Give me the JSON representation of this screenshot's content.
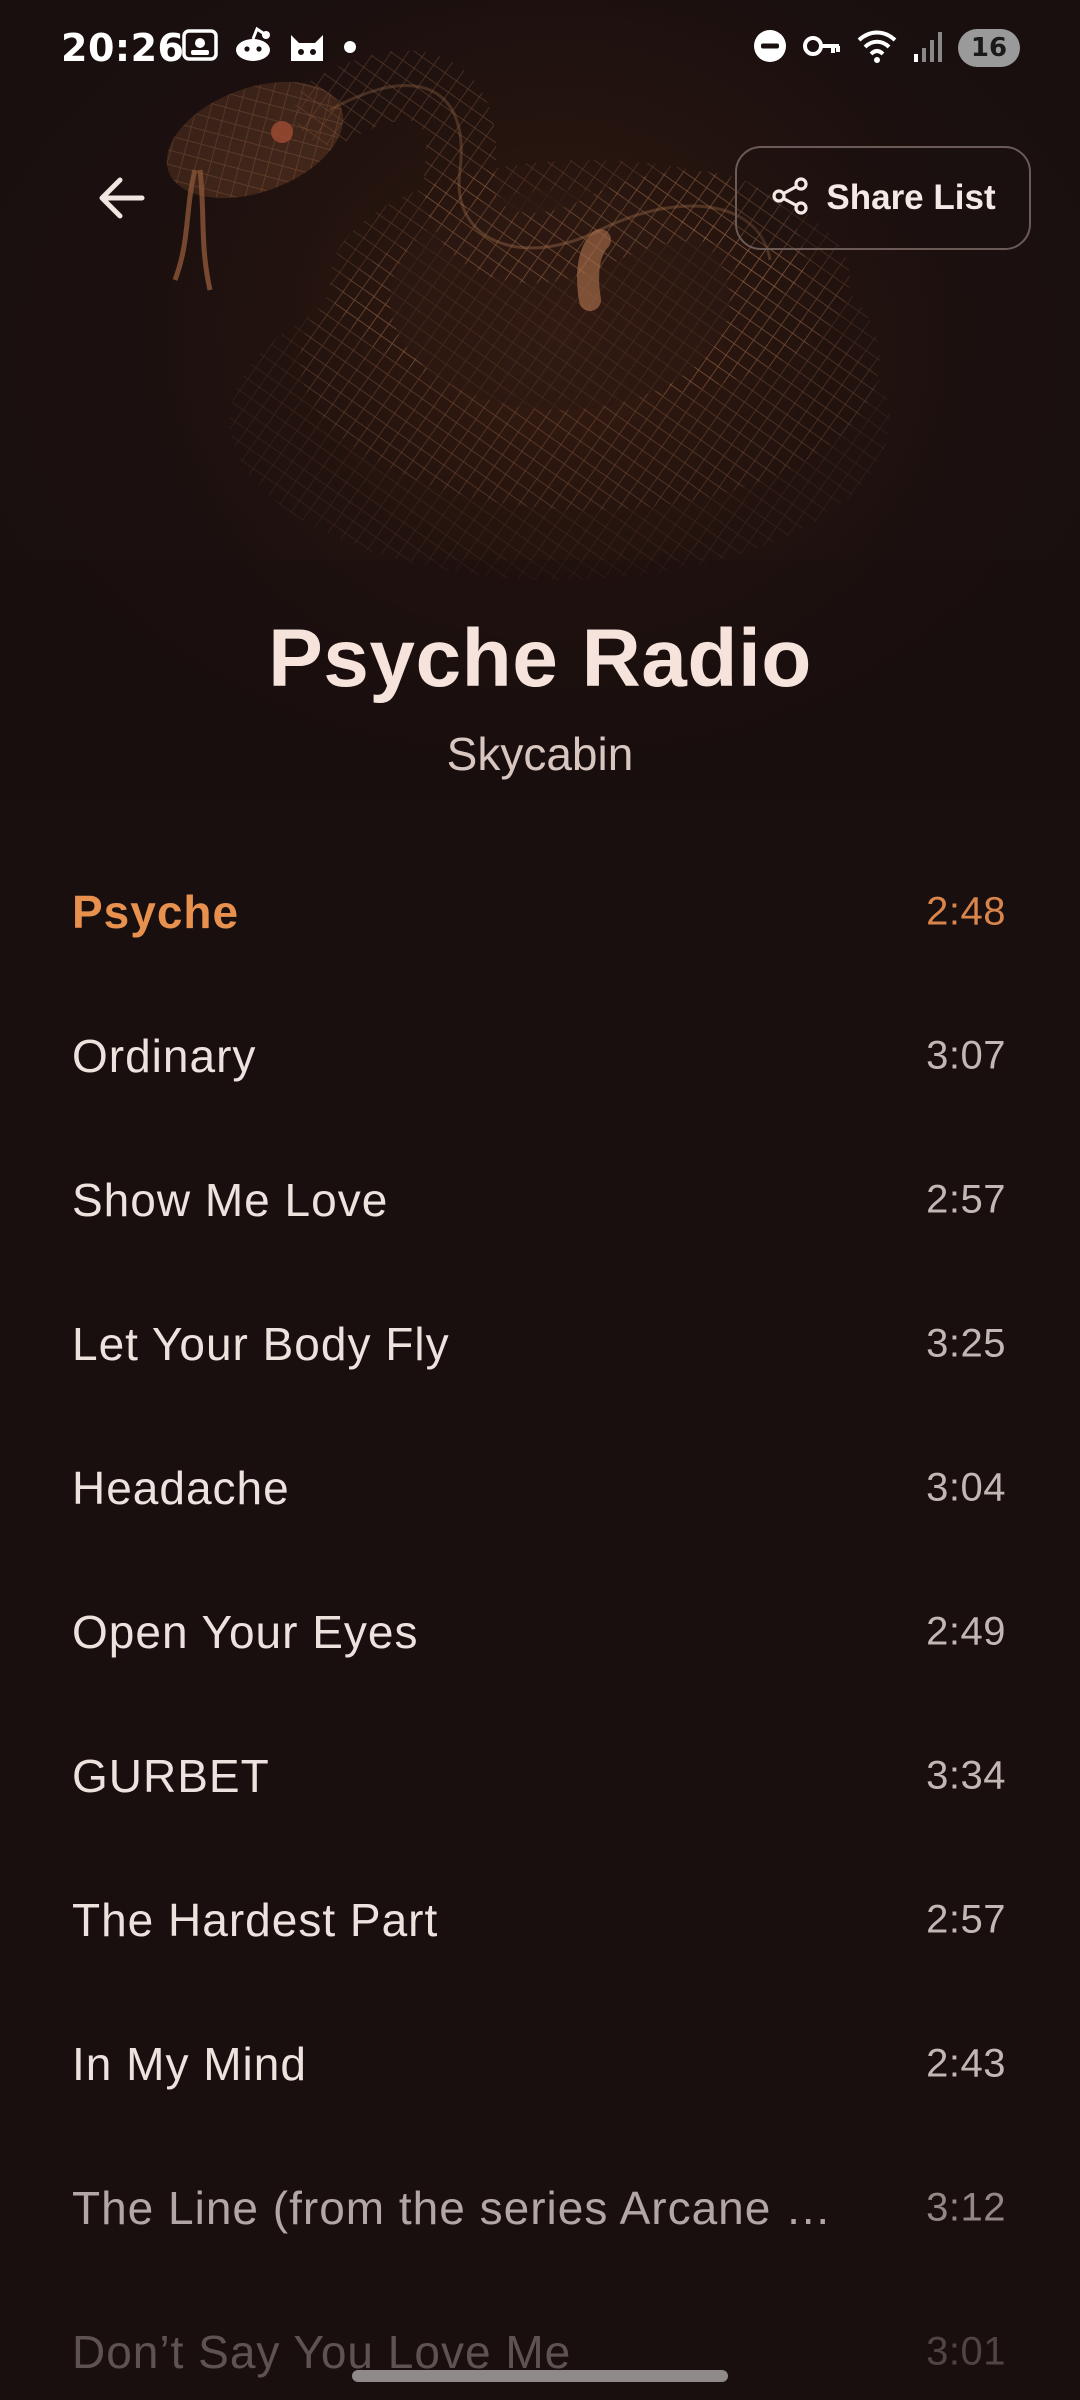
{
  "status_bar": {
    "time": "20:26",
    "left_icons": [
      "screenshot-icon",
      "reddit-icon",
      "cat-app-icon",
      "notification-dot-icon"
    ],
    "right_icons": [
      "do-not-disturb-icon",
      "vpn-key-icon",
      "wifi-icon",
      "signal-icon"
    ],
    "battery": "16"
  },
  "header": {
    "back_icon": "arrow-left-icon",
    "share_icon": "share-icon",
    "share_label": "Share List"
  },
  "album": {
    "cover_art": "snake-wireframe-artwork",
    "title": "Psyche Radio",
    "artist": "Skycabin"
  },
  "tracks": [
    {
      "title": "Psyche",
      "duration": "2:48"
    },
    {
      "title": "Ordinary",
      "duration": "3:07"
    },
    {
      "title": "Show Me Love",
      "duration": "2:57"
    },
    {
      "title": "Let Your Body Fly",
      "duration": "3:25"
    },
    {
      "title": "Headache",
      "duration": "3:04"
    },
    {
      "title": "Open Your Eyes",
      "duration": "2:49"
    },
    {
      "title": "GURBET",
      "duration": "3:34"
    },
    {
      "title": "The Hardest Part",
      "duration": "2:57"
    },
    {
      "title": "In My Mind",
      "duration": "2:43"
    },
    {
      "title": "The Line (from the series Arcane …",
      "duration": "3:12"
    },
    {
      "title": "Don’t Say You Love Me",
      "duration": "3:01"
    }
  ],
  "colors": {
    "background": "#190f0f",
    "accent": "#e8914f",
    "text": "#eee2de",
    "muted": "#c4b6b2"
  }
}
